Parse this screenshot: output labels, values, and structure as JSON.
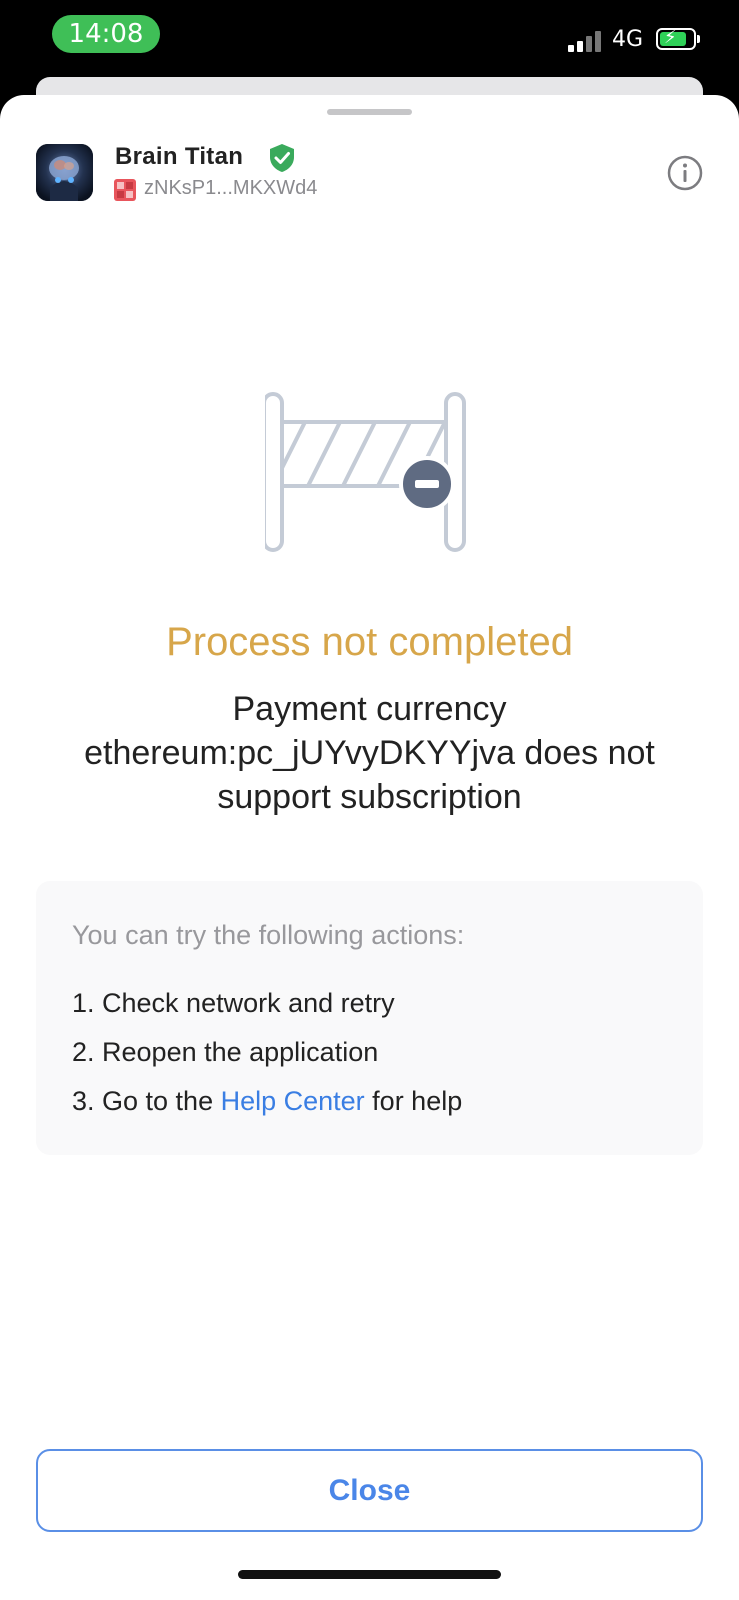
{
  "status_bar": {
    "time": "14:08",
    "network": "4G",
    "icons": [
      "signal-icon",
      "battery-charging-icon"
    ]
  },
  "header": {
    "app_name": "Brain Titan",
    "address": "zNKsP1...MKXWd4",
    "icons": [
      "app-icon",
      "verified-shield-icon",
      "address-icon",
      "info-icon"
    ]
  },
  "result": {
    "title": "Process not completed",
    "message": "Payment currency ethereum:pc_jUYvyDKYYjva does not support subscription",
    "illustration": "barrier-icon"
  },
  "actions": {
    "intro": "You can try the following actions:",
    "item1": "1. Check network and retry",
    "item2": "2. Reopen the application",
    "item3_prefix": "3. Go to the ",
    "item3_link": "Help Center",
    "item3_suffix": " for help"
  },
  "footer": {
    "close_label": "Close"
  },
  "colors": {
    "title": "#d7a64a",
    "link": "#3a7ee3",
    "time_pill": "#3fbf57",
    "verified": "#3aaa5c"
  }
}
